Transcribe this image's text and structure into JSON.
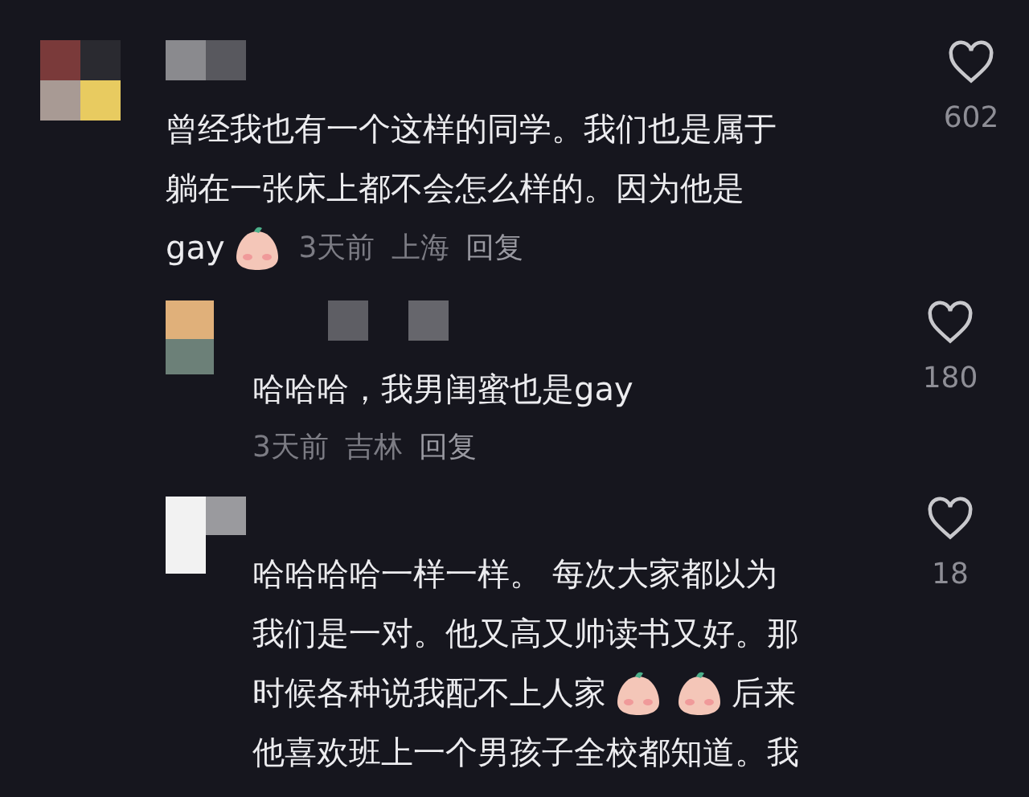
{
  "comments": [
    {
      "lines": [
        [
          {
            "kind": "text",
            "text": "曾经我也有一个这样的同学。我们也是属于"
          }
        ],
        [
          {
            "kind": "text",
            "text": "躺在一张床上都不会怎么样的。因为他是"
          }
        ],
        [
          {
            "kind": "text",
            "text": "gay"
          },
          {
            "kind": "emoji"
          }
        ]
      ],
      "time": "3天前",
      "location": "上海",
      "reply": "回复",
      "likes": "602",
      "liked": false,
      "children": [
        {
          "lines": [
            [
              {
                "kind": "text",
                "text": "哈哈哈，我男闺蜜也是gay"
              }
            ]
          ],
          "time": "3天前",
          "location": "吉林",
          "reply": "回复",
          "likes": "180",
          "liked": false
        },
        {
          "lines": [
            [
              {
                "kind": "text",
                "text": "哈哈哈哈一样一样。 每次大家都以为"
              }
            ],
            [
              {
                "kind": "text",
                "text": "我们是一对。他又高又帅读书又好。那"
              }
            ],
            [
              {
                "kind": "text",
                "text": "时候各种说我配不上人家"
              },
              {
                "kind": "emoji"
              },
              {
                "kind": "emoji"
              },
              {
                "kind": "text",
                "text": "后来"
              }
            ],
            [
              {
                "kind": "text",
                "text": "他喜欢班上一个男孩子全校都知道。我"
              }
            ]
          ],
          "likes": "18",
          "liked": false
        }
      ]
    }
  ]
}
